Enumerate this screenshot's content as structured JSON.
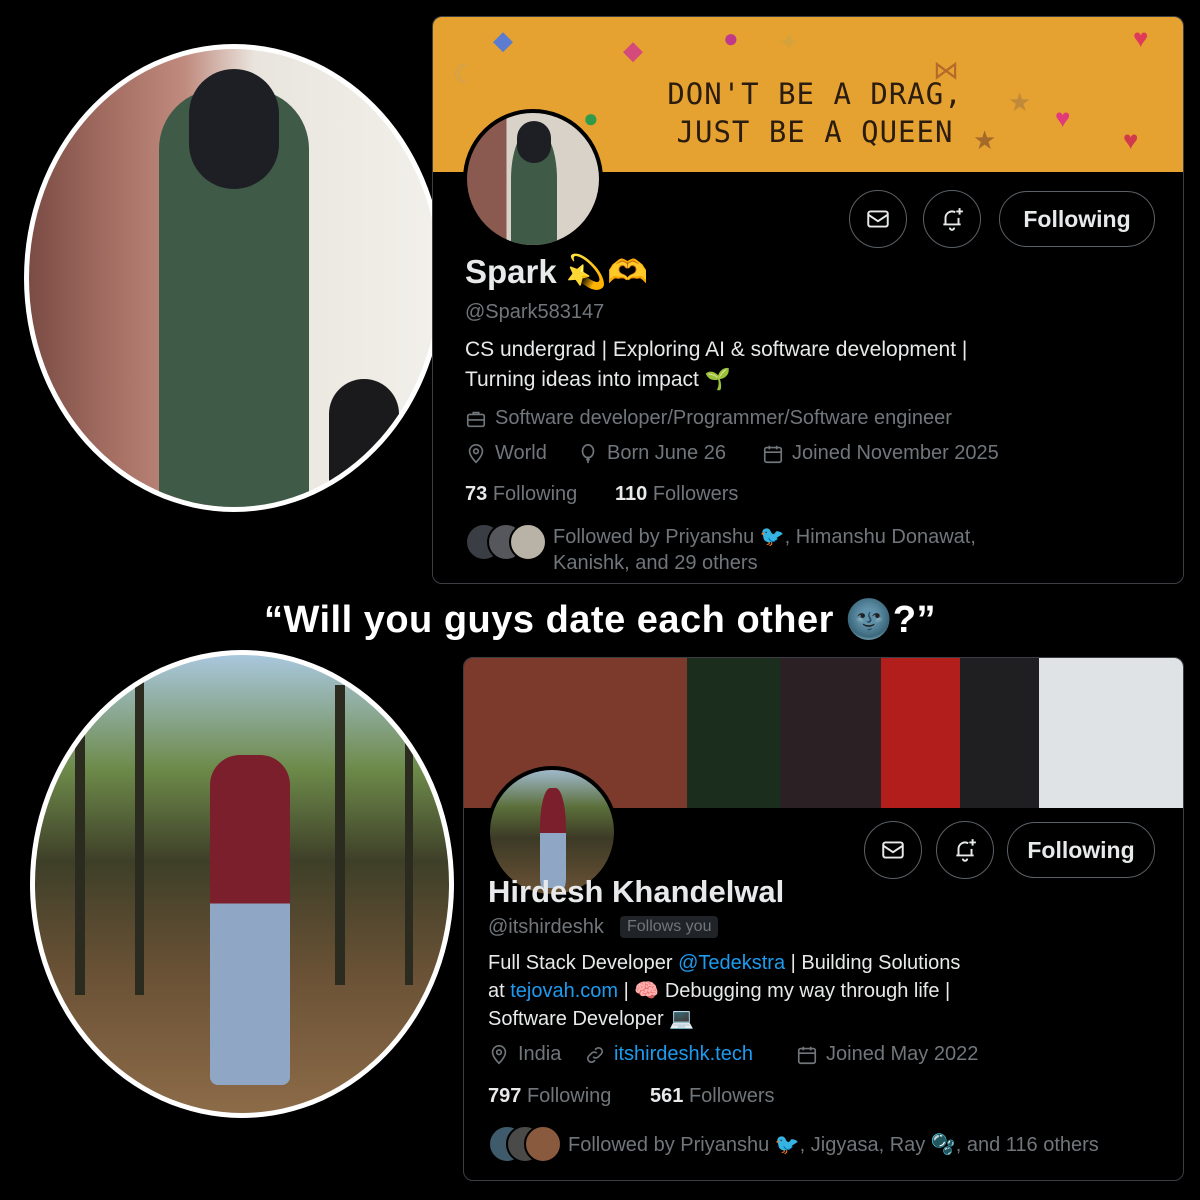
{
  "caption": "“Will you guys date each other 🌚?”",
  "profile1": {
    "name": "Spark 💫🫶",
    "handle": "@Spark583147",
    "banner_lines": [
      "DON'T BE A DRAG,",
      "JUST BE A QUEEN"
    ],
    "bio_line1": "CS undergrad | Exploring AI & software development |",
    "bio_line2": "Turning ideas into impact 🌱",
    "profession": "Software developer/Programmer/Software engineer",
    "location": "World",
    "birthday": "Born June 26",
    "joined": "Joined November 2025",
    "following_count": "73",
    "following_label": "Following",
    "followers_count": "110",
    "followers_label": "Followers",
    "followed_by_line1": "Followed by Priyanshu 🐦, Himanshu Donawat,",
    "followed_by_line2": "Kanishk, and 29 others",
    "follow_button": "Following",
    "icons": [
      "mail-icon",
      "bell-plus-icon",
      "briefcase-icon",
      "location-pin-icon",
      "balloon-icon",
      "calendar-icon"
    ]
  },
  "profile2": {
    "name": "Hirdesh Khandelwal",
    "handle": "@itshirdeshk",
    "follows_you": "Follows you",
    "bio_prefix": "Full Stack Developer ",
    "bio_mention": "@Tedekstra",
    "bio_mid": " | Building Solutions",
    "bio_at": "at ",
    "bio_link": "tejovah.com",
    "bio_rest": " | 🧠 Debugging my way through life |",
    "bio_line3": "Software Developer 💻",
    "location": "India",
    "website": "itshirdeshk.tech",
    "joined": "Joined May 2022",
    "following_count": "797",
    "following_label": "Following",
    "followers_count": "561",
    "followers_label": "Followers",
    "followed_by": "Followed by Priyanshu 🐦, Jigyasa, Ray 🫧, and 116 others",
    "follow_button": "Following",
    "icons": [
      "mail-icon",
      "bell-plus-icon",
      "location-pin-icon",
      "link-icon",
      "calendar-icon"
    ]
  },
  "colors": {
    "background": "#000000",
    "text": "#e7e9ea",
    "muted": "#71767b",
    "link": "#1d9bf0",
    "border": "#3b3f44",
    "banner1": "#e6a231"
  }
}
